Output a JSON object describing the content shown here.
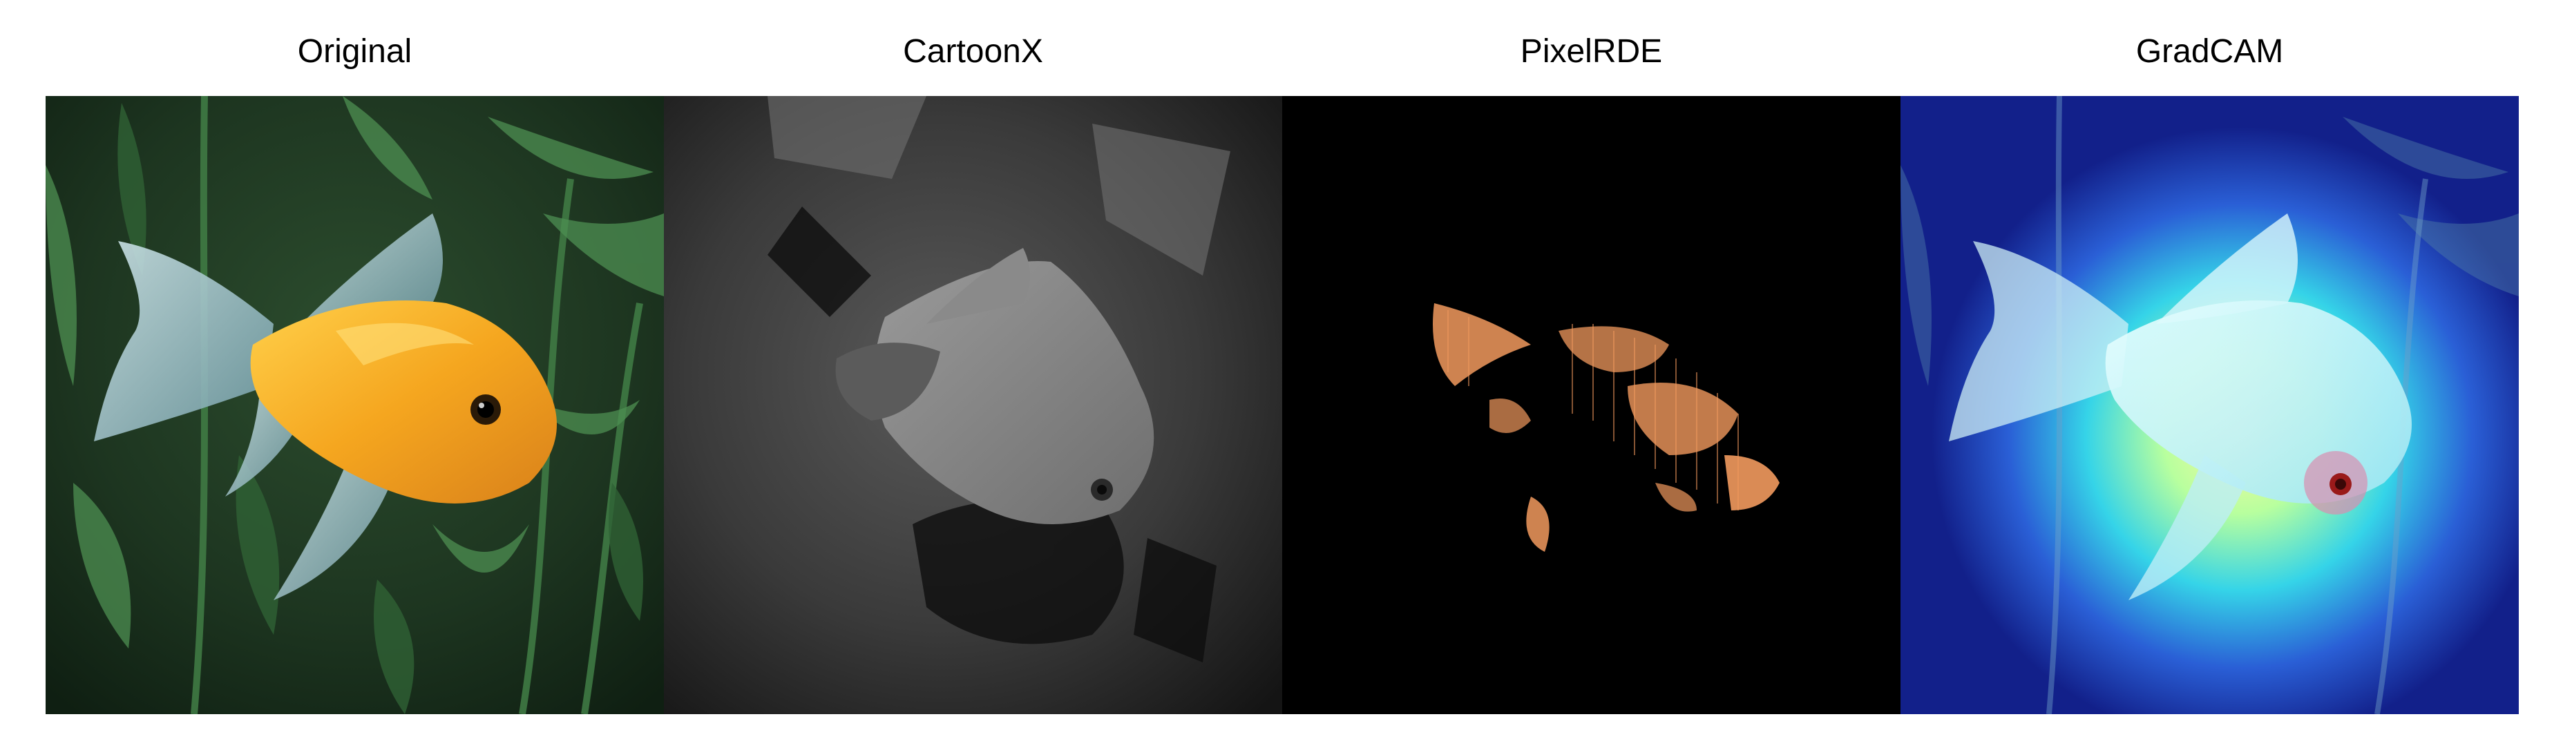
{
  "panels": [
    {
      "title": "Original"
    },
    {
      "title": "CartoonX"
    },
    {
      "title": "PixelRDE"
    },
    {
      "title": "GradCAM"
    }
  ],
  "colors": {
    "background": "#ffffff",
    "title_text": "#000000",
    "original_bg": "#1f3d22",
    "fish_orange": "#f3a423",
    "cartoonx_bg": "#2a2a2a",
    "pixelrde_bg": "#000000",
    "pixelrde_highlight": "#f29a5e",
    "gradcam_bg": "#12208a",
    "gradcam_hot": "#c8ff9a"
  }
}
